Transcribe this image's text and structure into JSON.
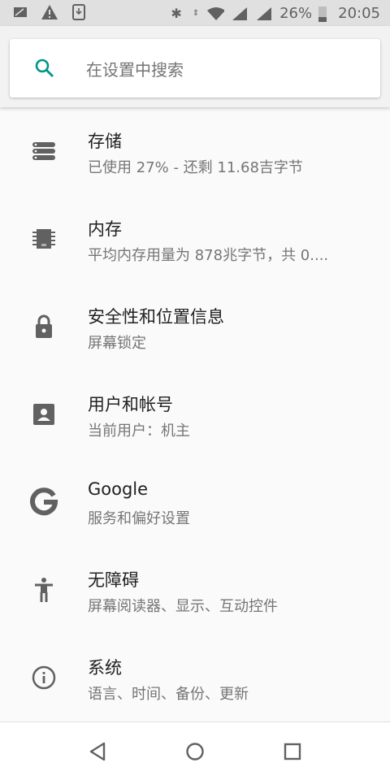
{
  "status_bar": {
    "battery": "26%",
    "time": "20:05"
  },
  "search": {
    "placeholder": "在设置中搜索"
  },
  "items": [
    {
      "title": "存储",
      "subtitle": "已使用 27% - 还剩 11.68吉字节",
      "icon": "storage-icon"
    },
    {
      "title": "内存",
      "subtitle": "平均内存用量为 878兆字节，共 0....",
      "icon": "memory-icon"
    },
    {
      "title": "安全性和位置信息",
      "subtitle": "屏幕锁定",
      "icon": "lock-icon"
    },
    {
      "title": "用户和帐号",
      "subtitle": "当前用户：机主",
      "icon": "account-icon"
    },
    {
      "title": "Google",
      "subtitle": "服务和偏好设置",
      "icon": "google-icon"
    },
    {
      "title": "无障碍",
      "subtitle": "屏幕阅读器、显示、互动控件",
      "icon": "accessibility-icon"
    },
    {
      "title": "系统",
      "subtitle": "语言、时间、备份、更新",
      "icon": "info-icon"
    }
  ]
}
